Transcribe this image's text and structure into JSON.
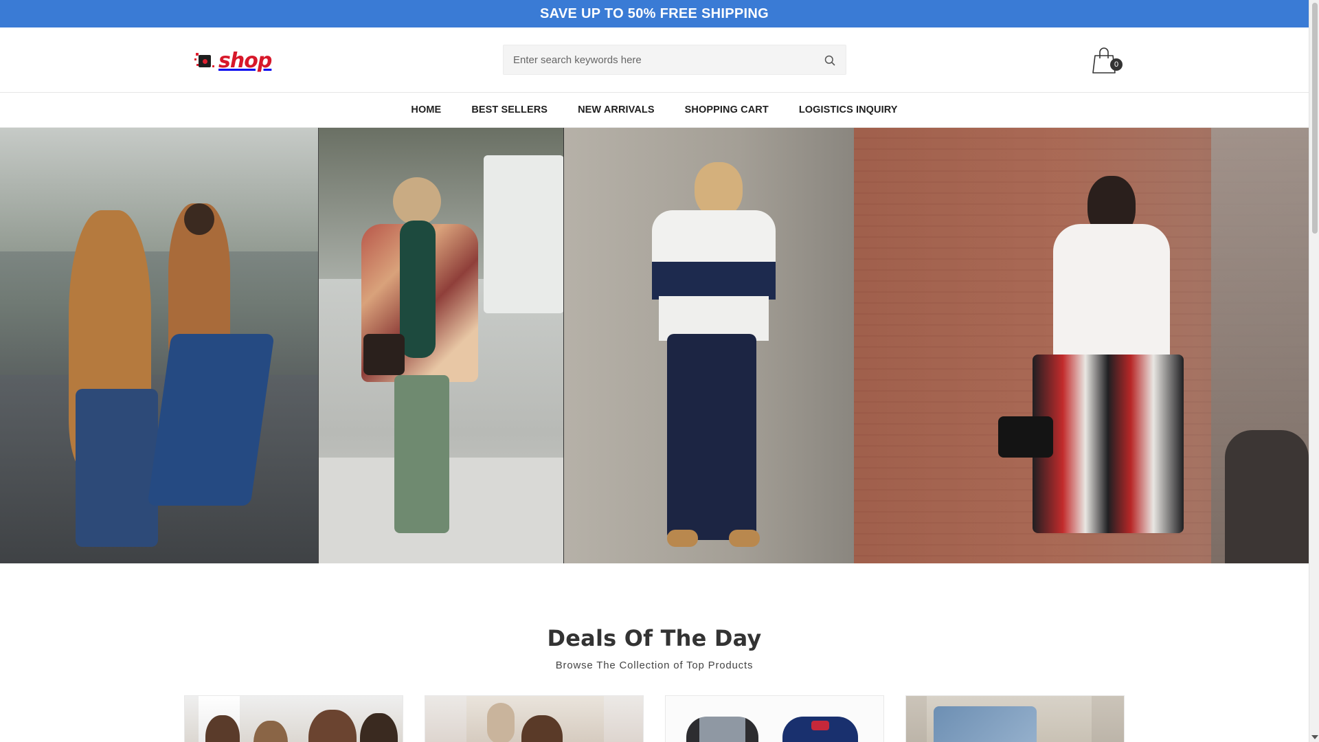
{
  "announcement": {
    "text": "SAVE UP TO 50% FREE SHIPPING",
    "bg_color": "#3a7bd5"
  },
  "header": {
    "logo_text": "shop",
    "logo_color": "#d7182a",
    "search": {
      "placeholder": "Enter search keywords here",
      "value": "",
      "icon": "search-icon"
    },
    "cart": {
      "icon": "shopping-bag-icon",
      "count": "0"
    }
  },
  "nav": {
    "items": [
      {
        "label": "HOME"
      },
      {
        "label": "BEST SELLERS"
      },
      {
        "label": "NEW ARRIVALS"
      },
      {
        "label": "SHOPPING CART"
      },
      {
        "label": "LOGISTICS INQUIRY"
      }
    ]
  },
  "hero": {
    "panels": [
      {
        "description_icon": "street-style-photo-1"
      },
      {
        "description_icon": "street-style-photo-2"
      },
      {
        "description_icon": "street-style-photo-3"
      },
      {
        "description_icon": "street-style-photo-4"
      }
    ]
  },
  "deals": {
    "title": "Deals Of The Day",
    "subtitle": "Browse The Collection of Top Products",
    "products": [
      {
        "image": "product-image-1"
      },
      {
        "image": "product-image-2"
      },
      {
        "image": "product-image-3"
      },
      {
        "image": "product-image-4"
      }
    ]
  }
}
